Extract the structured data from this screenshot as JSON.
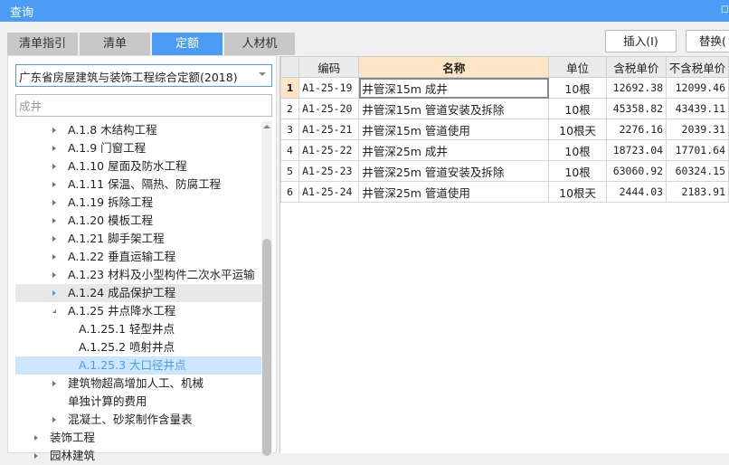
{
  "title": "查询",
  "tabs": [
    "清单指引",
    "清单",
    "定额",
    "人材机"
  ],
  "active_tab": 2,
  "dropdown_value": "广东省房屋建筑与装饰工程综合定额(2018)",
  "search_value": "成井",
  "tree": [
    {
      "label": "A.1.8 木结构工程",
      "level": 1,
      "arrow": "closed"
    },
    {
      "label": "A.1.9 门窗工程",
      "level": 1,
      "arrow": "closed"
    },
    {
      "label": "A.1.10 屋面及防水工程",
      "level": 1,
      "arrow": "closed"
    },
    {
      "label": "A.1.11 保温、隔热、防腐工程",
      "level": 1,
      "arrow": "closed"
    },
    {
      "label": "A.1.19 拆除工程",
      "level": 1,
      "arrow": "closed"
    },
    {
      "label": "A.1.20 模板工程",
      "level": 1,
      "arrow": "closed"
    },
    {
      "label": "A.1.21 脚手架工程",
      "level": 1,
      "arrow": "closed"
    },
    {
      "label": "A.1.22 垂直运输工程",
      "level": 1,
      "arrow": "closed"
    },
    {
      "label": "A.1.23 材料及小型构件二次水平运输",
      "level": 1,
      "arrow": "closed"
    },
    {
      "label": "A.1.24 成品保护工程",
      "level": 1,
      "arrow": "closed",
      "state": "hover"
    },
    {
      "label": "A.1.25 井点降水工程",
      "level": 1,
      "arrow": "open"
    },
    {
      "label": "A.1.25.1 轻型井点",
      "level": 2,
      "arrow": "none"
    },
    {
      "label": "A.1.25.2 喷射井点",
      "level": 2,
      "arrow": "none"
    },
    {
      "label": "A.1.25.3 大口径井点",
      "level": 2,
      "arrow": "none",
      "state": "sel"
    },
    {
      "label": "建筑物超高增加人工、机械",
      "level": 1,
      "arrow": "closed"
    },
    {
      "label": "单独计算的费用",
      "level": 1,
      "arrow": "none"
    },
    {
      "label": "混凝土、砂浆制作含量表",
      "level": 1,
      "arrow": "closed"
    },
    {
      "label": "装饰工程",
      "level": 0,
      "arrow": "closed"
    },
    {
      "label": "园林建筑",
      "level": 0,
      "arrow": "closed"
    }
  ],
  "buttons": {
    "insert": "插入(I)",
    "replace": "替换("
  },
  "columns": [
    "编码",
    "名称",
    "单位",
    "含税单价",
    "不含税单价"
  ],
  "rows": [
    {
      "n": "1",
      "code": "A1-25-19",
      "name": "井管深15m 成井",
      "unit": "10根",
      "tax": "12692.38",
      "notax": "12099.46"
    },
    {
      "n": "2",
      "code": "A1-25-20",
      "name": "井管深15m 管道安装及拆除",
      "unit": "10根",
      "tax": "45358.82",
      "notax": "43439.11"
    },
    {
      "n": "3",
      "code": "A1-25-21",
      "name": "井管深15m 管道使用",
      "unit": "10根天",
      "tax": "2276.16",
      "notax": "2039.31"
    },
    {
      "n": "4",
      "code": "A1-25-22",
      "name": "井管深25m 成井",
      "unit": "10根",
      "tax": "18723.04",
      "notax": "17701.64"
    },
    {
      "n": "5",
      "code": "A1-25-23",
      "name": "井管深25m 管道安装及拆除",
      "unit": "10根",
      "tax": "63060.92",
      "notax": "60324.15"
    },
    {
      "n": "6",
      "code": "A1-25-24",
      "name": "井管深25m 管道使用",
      "unit": "10根天",
      "tax": "2444.03",
      "notax": "2183.91"
    }
  ]
}
